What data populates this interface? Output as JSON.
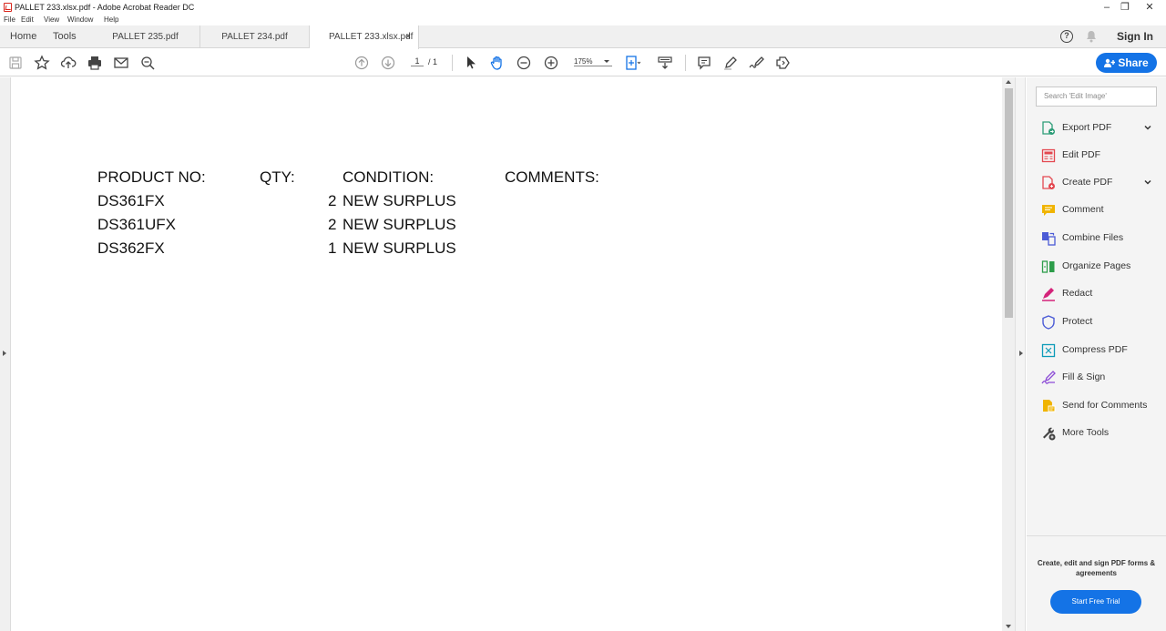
{
  "window": {
    "title": "PALLET 233.xlsx.pdf - Adobe Acrobat Reader DC",
    "minimize": "–",
    "maximize": "❐",
    "close": "✕"
  },
  "menu": [
    "File",
    "Edit",
    "View",
    "Window",
    "Help"
  ],
  "nav": {
    "home": "Home",
    "tools": "Tools"
  },
  "tabs": [
    {
      "label": "PALLET 235.pdf"
    },
    {
      "label": "PALLET 234.pdf"
    },
    {
      "label": "PALLET 233.xlsx.pdf",
      "close": "×"
    }
  ],
  "account": {
    "help_icon": "help-icon",
    "bell_icon": "bell-icon",
    "sign_in": "Sign In"
  },
  "toolbar": {
    "page_current": "1",
    "page_total": "/ 1",
    "zoom": "175%",
    "share": "Share"
  },
  "document": {
    "headers": [
      "PRODUCT NO:",
      "QTY:",
      "CONDITION:",
      "COMMENTS:"
    ],
    "rows": [
      {
        "product": "DS361FX",
        "qty": "2",
        "condition": "NEW SURPLUS"
      },
      {
        "product": "DS361UFX",
        "qty": "2",
        "condition": "NEW SURPLUS"
      },
      {
        "product": "DS362FX",
        "qty": "1",
        "condition": "NEW SURPLUS"
      }
    ]
  },
  "tools_pane": {
    "search_placeholder": "Search 'Edit Image'",
    "items": [
      {
        "label": "Export PDF",
        "icon": "export-pdf-icon",
        "color": "#2d9d78"
      },
      {
        "label": "Edit PDF",
        "icon": "edit-pdf-icon",
        "color": "#e34850"
      },
      {
        "label": "Create PDF",
        "icon": "create-pdf-icon",
        "color": "#e34850"
      },
      {
        "label": "Comment",
        "icon": "comment-icon",
        "color": "#f0b400"
      },
      {
        "label": "Combine Files",
        "icon": "combine-files-icon",
        "color": "#4b5bd6"
      },
      {
        "label": "Organize Pages",
        "icon": "organize-pages-icon",
        "color": "#2d9d4a"
      },
      {
        "label": "Redact",
        "icon": "redact-icon",
        "color": "#d4237a"
      },
      {
        "label": "Protect",
        "icon": "protect-icon",
        "color": "#4b5bd6"
      },
      {
        "label": "Compress PDF",
        "icon": "compress-pdf-icon",
        "color": "#0d9bb8"
      },
      {
        "label": "Fill & Sign",
        "icon": "fill-sign-icon",
        "color": "#8c4bd6"
      },
      {
        "label": "Send for Comments",
        "icon": "send-for-comments-icon",
        "color": "#f0b400"
      },
      {
        "label": "More Tools",
        "icon": "more-tools-icon",
        "color": "#444444"
      }
    ],
    "promo_text": "Create, edit and sign PDF forms & agreements",
    "promo_button": "Start Free Trial"
  }
}
